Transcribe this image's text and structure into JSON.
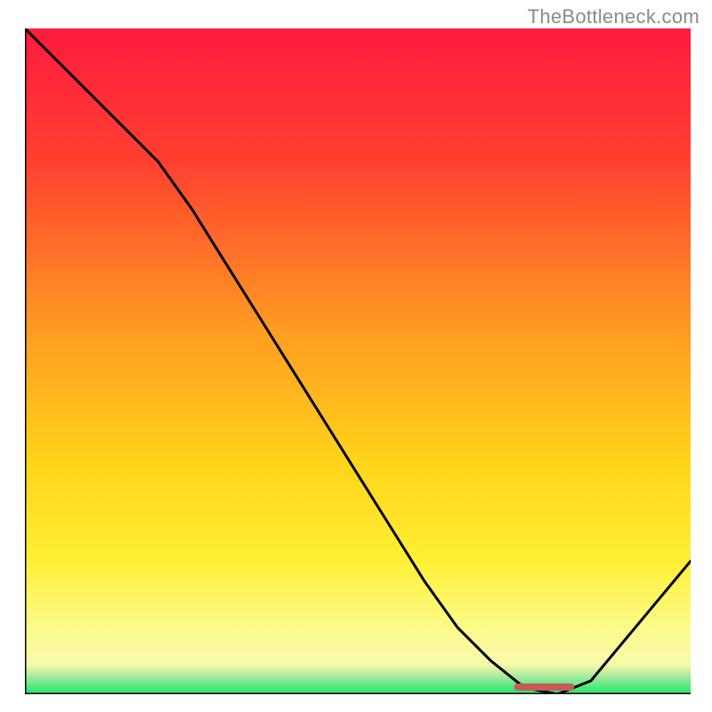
{
  "watermark": "TheBottleneck.com",
  "chart_data": {
    "type": "line",
    "title": "",
    "xlabel": "",
    "ylabel": "",
    "xlim": [
      0,
      100
    ],
    "ylim": [
      0,
      100
    ],
    "x": [
      0,
      5,
      10,
      15,
      20,
      25,
      30,
      35,
      40,
      45,
      50,
      55,
      60,
      65,
      70,
      75,
      80,
      85,
      90,
      95,
      100
    ],
    "values": [
      100,
      95,
      90,
      85,
      80,
      73,
      65,
      57,
      49,
      41,
      33,
      25,
      17,
      10,
      5,
      1,
      0,
      2,
      8,
      14,
      20
    ],
    "optimal_band_x": [
      74,
      82
    ],
    "gradient_stops": [
      {
        "offset": 0.0,
        "color": "#ff1a3f"
      },
      {
        "offset": 0.2,
        "color": "#ff4030"
      },
      {
        "offset": 0.45,
        "color": "#ff9a22"
      },
      {
        "offset": 0.65,
        "color": "#ffd41a"
      },
      {
        "offset": 0.8,
        "color": "#fff035"
      },
      {
        "offset": 0.9,
        "color": "#fbfb8a"
      },
      {
        "offset": 0.955,
        "color": "#f8faac"
      },
      {
        "offset": 0.975,
        "color": "#9fe89a"
      },
      {
        "offset": 1.0,
        "color": "#19e86c"
      }
    ],
    "line_color": "#000000",
    "accent_segment_color": "#c85a5a",
    "axes_color": "#000000"
  }
}
